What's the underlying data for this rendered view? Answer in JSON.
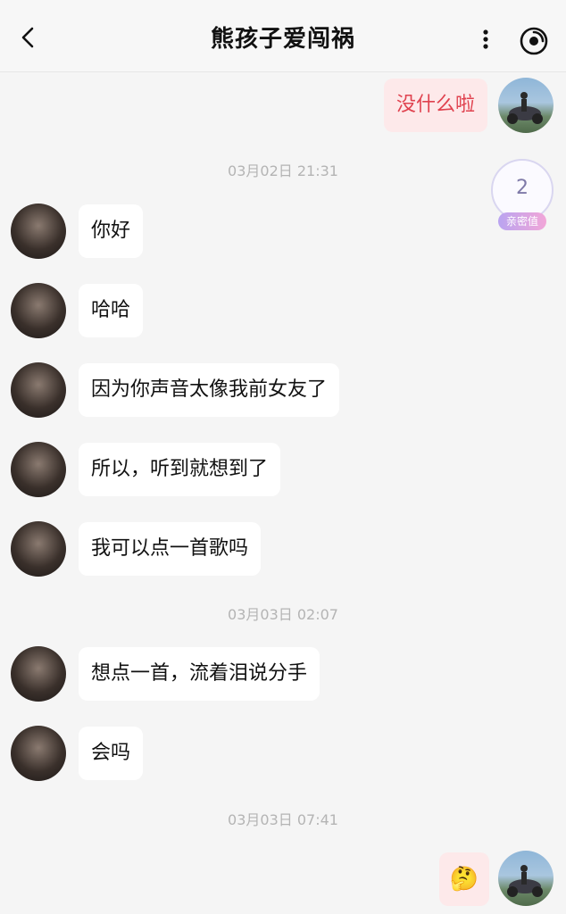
{
  "header": {
    "title": "熊孩子爱闯祸"
  },
  "intimacy": {
    "value": "2",
    "label": "亲密值"
  },
  "messages": [
    {
      "sender": "me",
      "text": "没什么啦"
    },
    {
      "sender": "them",
      "text": "你好"
    },
    {
      "sender": "them",
      "text": "哈哈"
    },
    {
      "sender": "them",
      "text": "因为你声音太像我前女友了"
    },
    {
      "sender": "them",
      "text": "所以，听到就想到了"
    },
    {
      "sender": "them",
      "text": "我可以点一首歌吗"
    },
    {
      "sender": "them",
      "text": "想点一首，流着泪说分手"
    },
    {
      "sender": "them",
      "text": "会吗"
    },
    {
      "sender": "me",
      "text": "🤔"
    }
  ],
  "timestamps": [
    "03月02日 21:31",
    "03月03日 02:07",
    "03月03日 07:41"
  ],
  "colors": {
    "my_bubble": "#fde9ea",
    "my_text": "#e0424f",
    "their_bubble": "#ffffff",
    "background": "#f5f5f5"
  }
}
